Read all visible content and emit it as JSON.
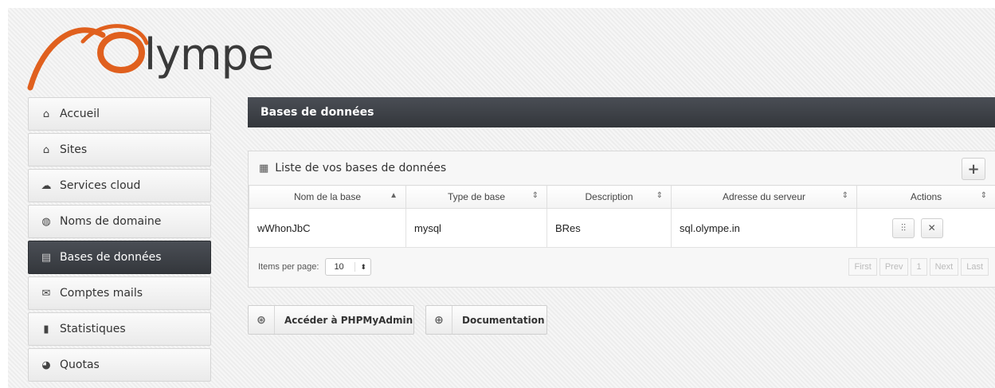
{
  "logo": {
    "text": "lympe",
    "colors": {
      "arc": "#e0601e",
      "text": "#3a3a3a"
    }
  },
  "sidebar": {
    "items": [
      {
        "label": "Accueil",
        "icon": "home-icon",
        "active": false
      },
      {
        "label": "Sites",
        "icon": "house-icon",
        "active": false
      },
      {
        "label": "Services cloud",
        "icon": "cloud-icon",
        "active": false
      },
      {
        "label": "Noms de domaine",
        "icon": "globe-icon",
        "active": false
      },
      {
        "label": "Bases de données",
        "icon": "database-icon",
        "active": true
      },
      {
        "label": "Comptes mails",
        "icon": "envelope-icon",
        "active": false
      },
      {
        "label": "Statistiques",
        "icon": "bar-chart-icon",
        "active": false
      },
      {
        "label": "Quotas",
        "icon": "pie-chart-icon",
        "active": false
      }
    ]
  },
  "header": {
    "title": "Bases de données"
  },
  "panel": {
    "title": "Liste de vos bases de données",
    "add_label": "+",
    "columns": [
      "Nom de la base",
      "Type de base",
      "Description",
      "Adresse du serveur",
      "Actions"
    ],
    "rows": [
      {
        "name": "wWhonJbC",
        "type": "mysql",
        "description": "BRes",
        "server": "sql.olympe.in"
      }
    ],
    "footer": {
      "items_per_page_label": "Items per page:",
      "items_per_page_value": "10",
      "pager": [
        "First",
        "Prev",
        "1",
        "Next",
        "Last"
      ]
    }
  },
  "buttons": {
    "phpmyadmin": "Accéder à PHPMyAdmin",
    "documentation": "Documentation"
  }
}
